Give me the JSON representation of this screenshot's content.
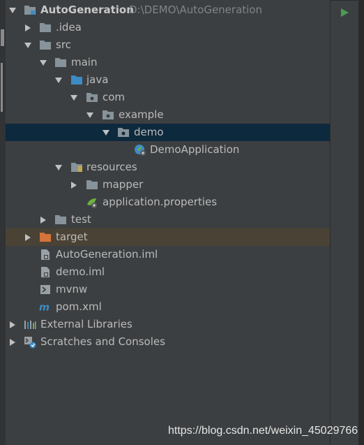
{
  "project": {
    "name": "AutoGeneration",
    "path": "D:\\DEMO\\AutoGeneration"
  },
  "tree": {
    "idea": ".idea",
    "src": "src",
    "main": "main",
    "java": "java",
    "com": "com",
    "example": "example",
    "demo": "demo",
    "demo_application": "DemoApplication",
    "resources": "resources",
    "mapper": "mapper",
    "application_properties": "application.properties",
    "test": "test",
    "target": "target",
    "autogeneration_iml": "AutoGeneration.iml",
    "demo_iml": "demo.iml",
    "mvnw": "mvnw",
    "pom_xml": "pom.xml",
    "external_libraries": "External Libraries",
    "scratches": "Scratches and Consoles"
  },
  "icons": {
    "folder": "folder-icon",
    "source_folder": "source-folder-icon",
    "package": "package-icon",
    "resources_folder": "resources-folder-icon",
    "excluded_folder": "excluded-folder-icon",
    "spring_class": "spring-boot-class-icon",
    "spring_properties": "spring-properties-icon",
    "module_file": "module-file-icon",
    "shell_script": "shell-script-icon",
    "maven": "maven-icon",
    "libraries": "libraries-icon",
    "scratches": "scratches-icon",
    "run": "run-icon"
  },
  "colors": {
    "background": "#3c3f41",
    "selection": "#0d293e",
    "excluded_row": "#4a4235",
    "text": "#bbbbbb",
    "path_text": "#7f8588",
    "folder": "#87939a",
    "source_folder": "#3d8bc4",
    "excluded_folder": "#d4733a",
    "run_green": "#499c54"
  },
  "watermark": "https://blog.csdn.net/weixin_45029766"
}
